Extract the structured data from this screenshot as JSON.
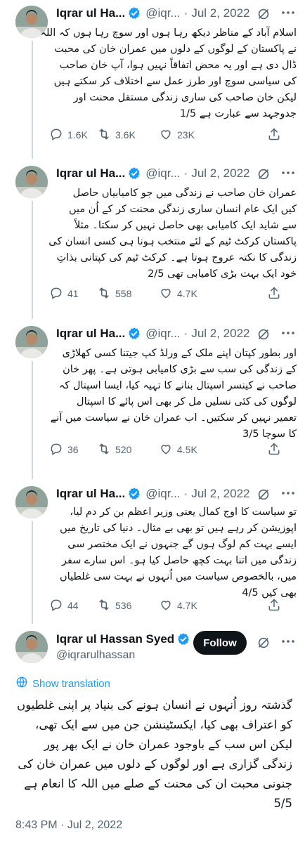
{
  "author": {
    "name_truncated": "Iqrar ul Ha...",
    "handle_truncated": "@iqr...",
    "full_name": "Iqrar ul Hassan Syed",
    "handle": "@iqrarulhassan",
    "separator": "·"
  },
  "colors": {
    "accent": "#1d9bf0",
    "text": "#0f1419",
    "muted": "#536471",
    "line": "#cfd9de"
  },
  "tweets": [
    {
      "date": "Jul 2, 2022",
      "lines": [
        "اسلام آباد کے مناظر دیکھ رہا ہوں اور سوچ رہا ہوں کہ اللہ",
        "نے پاکستان کے لوگوں کے دلوں میں عمران خان کی محبت",
        "ڈال دی ہے اور یہ محض اتفاقاً نہیں ہوا، آپ خان صاحب",
        "کی سیاسی سوچ اور طرز عمل سے اختلاف کر سکتے ہیں",
        "لیکن خان صاحب کی ساری زندگی مستقل محنت اور",
        "جدوجہد سے عبارت ہے 1/5"
      ],
      "replies": "1.6K",
      "retweets": "3.6K",
      "likes": "23K"
    },
    {
      "date": "Jul 2, 2022",
      "lines": [
        "عمران خان صاحب نے زندگی میں جو کامیابیاں حاصل",
        "کیں ایک عام انسان ساری زندگی محنت کر کے اُن میں",
        "سے شاید ایک کامیابی بھی حاصل نہیں کر سکتا۔ مثلاً",
        "پاکستان کرکٹ ٹیم کے لئے منتخب ہونا ہی کسی انسان کی",
        "زندگی کا نکتہ عروج ہوتا ہے۔ کرکٹ ٹیم کی کپتانی بذاتِ",
        "خود ایک بہت بڑی کامیابی تھی 2/5"
      ],
      "replies": "41",
      "retweets": "558",
      "likes": "4.7K"
    },
    {
      "date": "Jul 2, 2022",
      "lines": [
        "اور بطور کپتان اپنے ملک کے ورلڈ کپ جیتنا کسی کھلاڑی",
        "کے زندگی کی سب سے بڑی کامیابی ہوتی ہے۔ پھر خان",
        "صاحب نے کینسر اسپتال بنانے کا تہیہ کیا، ایسا اسپتال کہ",
        "لوگوں کی کئی نسلیں مل کر بھی اس پائے کا اسپتال",
        "تعمیر نہیں کر سکتیں۔ اب عمران خان نے سیاست میں آنے",
        "کا سوچا 3/5"
      ],
      "replies": "36",
      "retweets": "520",
      "likes": "4.5K"
    },
    {
      "date": "Jul 2, 2022",
      "lines": [
        "تو سیاست کا اوج کمال یعنی وزیر اعظم بن کر دم لیا،",
        "اپوزیشن کر رہے ہیں تو بھی بے مثال۔ دنیا کی تاریخ میں",
        "ایسے بہت کم لوگ ہوں گے جنہوں نے ایک مختصر سی",
        "زندگی میں اتنا بہت کچھ حاصل کیا ہو۔ اس سارے سفر",
        "میں، بالخصوص سیاست میں اُنہوں نے بہت سی غلطیاں",
        "بھی کیں 4/5"
      ],
      "replies": "44",
      "retweets": "536",
      "likes": "4.7K"
    }
  ],
  "main_tweet": {
    "follow_label": "Follow",
    "show_translation": "Show translation",
    "lines": [
      "گذشتہ روز اُنہوں نے انسان ہونے کی بنیاد پر اپنی غلطیوں",
      "کو اعتراف بھی کیا، ایکسٹینشن جن میں سے ایک تھی،",
      "لیکن اس سب کے باوجود عمران خان نے ایک بھر پور",
      "زندگی گزاری ہے اور لوگوں کے دلوں میں عمران خان کی",
      "جنونی محبت ان کی محنت کے صلے میں اللہ کا انعام ہے",
      "5/5"
    ],
    "timestamp": "8:43 PM · Jul 2, 2022"
  }
}
